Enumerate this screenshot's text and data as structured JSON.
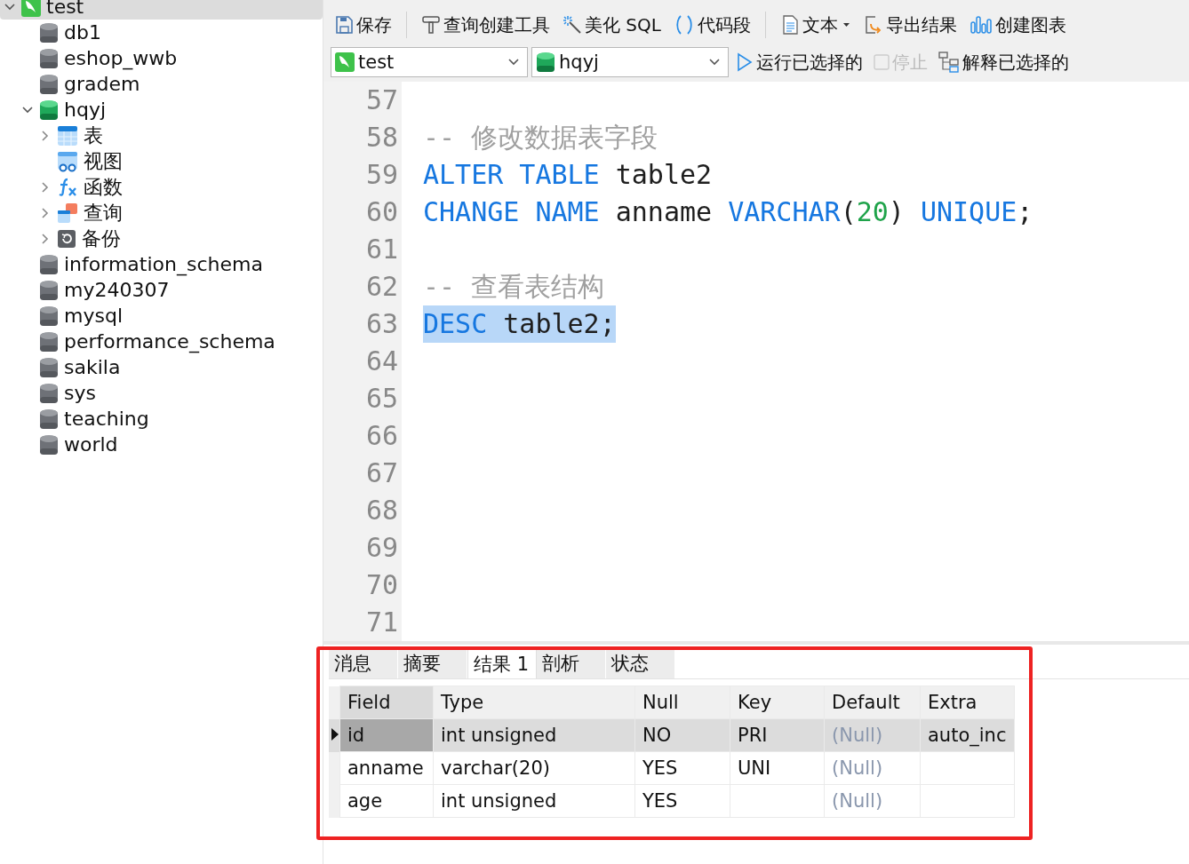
{
  "tree": [
    {
      "label": "test",
      "kind": "connection",
      "expanded": true,
      "selected": true,
      "children": [
        {
          "label": "db1",
          "kind": "database"
        },
        {
          "label": "eshop_wwb",
          "kind": "database"
        },
        {
          "label": "gradem",
          "kind": "database"
        },
        {
          "label": "hqyj",
          "kind": "database-open",
          "expanded": true,
          "children": [
            {
              "label": "表",
              "kind": "tables",
              "expanded": false
            },
            {
              "label": "视图",
              "kind": "views"
            },
            {
              "label": "函数",
              "kind": "functions",
              "expanded": false
            },
            {
              "label": "查询",
              "kind": "queries",
              "expanded": false
            },
            {
              "label": "备份",
              "kind": "backups",
              "expanded": false
            }
          ]
        },
        {
          "label": "information_schema",
          "kind": "database"
        },
        {
          "label": "my240307",
          "kind": "database"
        },
        {
          "label": "mysql",
          "kind": "database"
        },
        {
          "label": "performance_schema",
          "kind": "database"
        },
        {
          "label": "sakila",
          "kind": "database"
        },
        {
          "label": "sys",
          "kind": "database"
        },
        {
          "label": "teaching",
          "kind": "database"
        },
        {
          "label": "world",
          "kind": "database"
        }
      ]
    }
  ],
  "toolbar": [
    {
      "label": "保存",
      "kind": "save"
    },
    {
      "label": "查询创建工具",
      "kind": "builder"
    },
    {
      "label": "美化 SQL",
      "kind": "beautify"
    },
    {
      "label": "代码段",
      "kind": "snippet"
    },
    {
      "label": "文本",
      "kind": "text"
    },
    {
      "label": "导出结果",
      "kind": "export"
    },
    {
      "label": "创建图表",
      "kind": "chart"
    }
  ],
  "connection_select": {
    "value": "test"
  },
  "database_select": {
    "value": "hqyj"
  },
  "run_bar": [
    {
      "label": "运行已选择的",
      "kind": "run",
      "disabled": false
    },
    {
      "label": "停止",
      "kind": "stop",
      "disabled": true
    },
    {
      "label": "解释已选择的",
      "kind": "explain",
      "disabled": false
    }
  ],
  "editor": {
    "lines": [
      {
        "number": "57"
      },
      {
        "number": "58",
        "selected": false,
        "tokens": [
          {
            "text": "-- 修改数据表字段",
            "kind": "comment"
          }
        ]
      },
      {
        "number": "59",
        "selected": false,
        "tokens": [
          {
            "text": "ALTER TABLE",
            "kind": "keyword"
          },
          {
            "text": " table2",
            "kind": "plain"
          }
        ]
      },
      {
        "number": "60",
        "selected": false,
        "tokens": [
          {
            "text": "CHANGE NAME",
            "kind": "keyword"
          },
          {
            "text": " anname ",
            "kind": "plain"
          },
          {
            "text": "VARCHAR",
            "kind": "keyword"
          },
          {
            "text": "(",
            "kind": "plain"
          },
          {
            "text": "20",
            "kind": "number"
          },
          {
            "text": ") ",
            "kind": "plain"
          },
          {
            "text": "UNIQUE",
            "kind": "keyword"
          },
          {
            "text": ";",
            "kind": "plain"
          }
        ]
      },
      {
        "number": "61"
      },
      {
        "number": "62",
        "selected": false,
        "tokens": [
          {
            "text": "-- 查看表结构",
            "kind": "comment"
          }
        ]
      },
      {
        "number": "63",
        "selected": true,
        "tokens": [
          {
            "text": "DESC",
            "kind": "keyword"
          },
          {
            "text": " table2;",
            "kind": "plain"
          }
        ]
      },
      {
        "number": "64"
      },
      {
        "number": "65"
      },
      {
        "number": "66"
      },
      {
        "number": "67"
      },
      {
        "number": "68"
      },
      {
        "number": "69"
      },
      {
        "number": "70"
      },
      {
        "number": "71"
      }
    ]
  },
  "results": {
    "tabs": [
      {
        "label": "消息",
        "selected": false
      },
      {
        "label": "摘要",
        "selected": false
      },
      {
        "label": "结果 1",
        "selected": true
      },
      {
        "label": "剖析",
        "selected": false
      },
      {
        "label": "状态",
        "selected": false
      }
    ],
    "columns": [
      "Field",
      "Type",
      "Null",
      "Key",
      "Default",
      "Extra"
    ],
    "rows": [
      {
        "selected": true,
        "cells": [
          {
            "text": "id",
            "is_null": false
          },
          {
            "text": "int unsigned",
            "is_null": false
          },
          {
            "text": "NO",
            "is_null": false
          },
          {
            "text": "PRI",
            "is_null": false
          },
          {
            "text": "(Null)",
            "is_null": true
          },
          {
            "text": "auto_inc",
            "is_null": false
          }
        ]
      },
      {
        "selected": false,
        "cells": [
          {
            "text": "anname",
            "is_null": false
          },
          {
            "text": "varchar(20)",
            "is_null": false
          },
          {
            "text": "YES",
            "is_null": false
          },
          {
            "text": "UNI",
            "is_null": false
          },
          {
            "text": "(Null)",
            "is_null": true
          },
          {}
        ]
      },
      {
        "selected": false,
        "cells": [
          {
            "text": "age",
            "is_null": false
          },
          {
            "text": "int unsigned",
            "is_null": false
          },
          {
            "text": "YES",
            "is_null": false
          },
          {},
          {
            "text": "(Null)",
            "is_null": true
          },
          {}
        ]
      }
    ]
  }
}
